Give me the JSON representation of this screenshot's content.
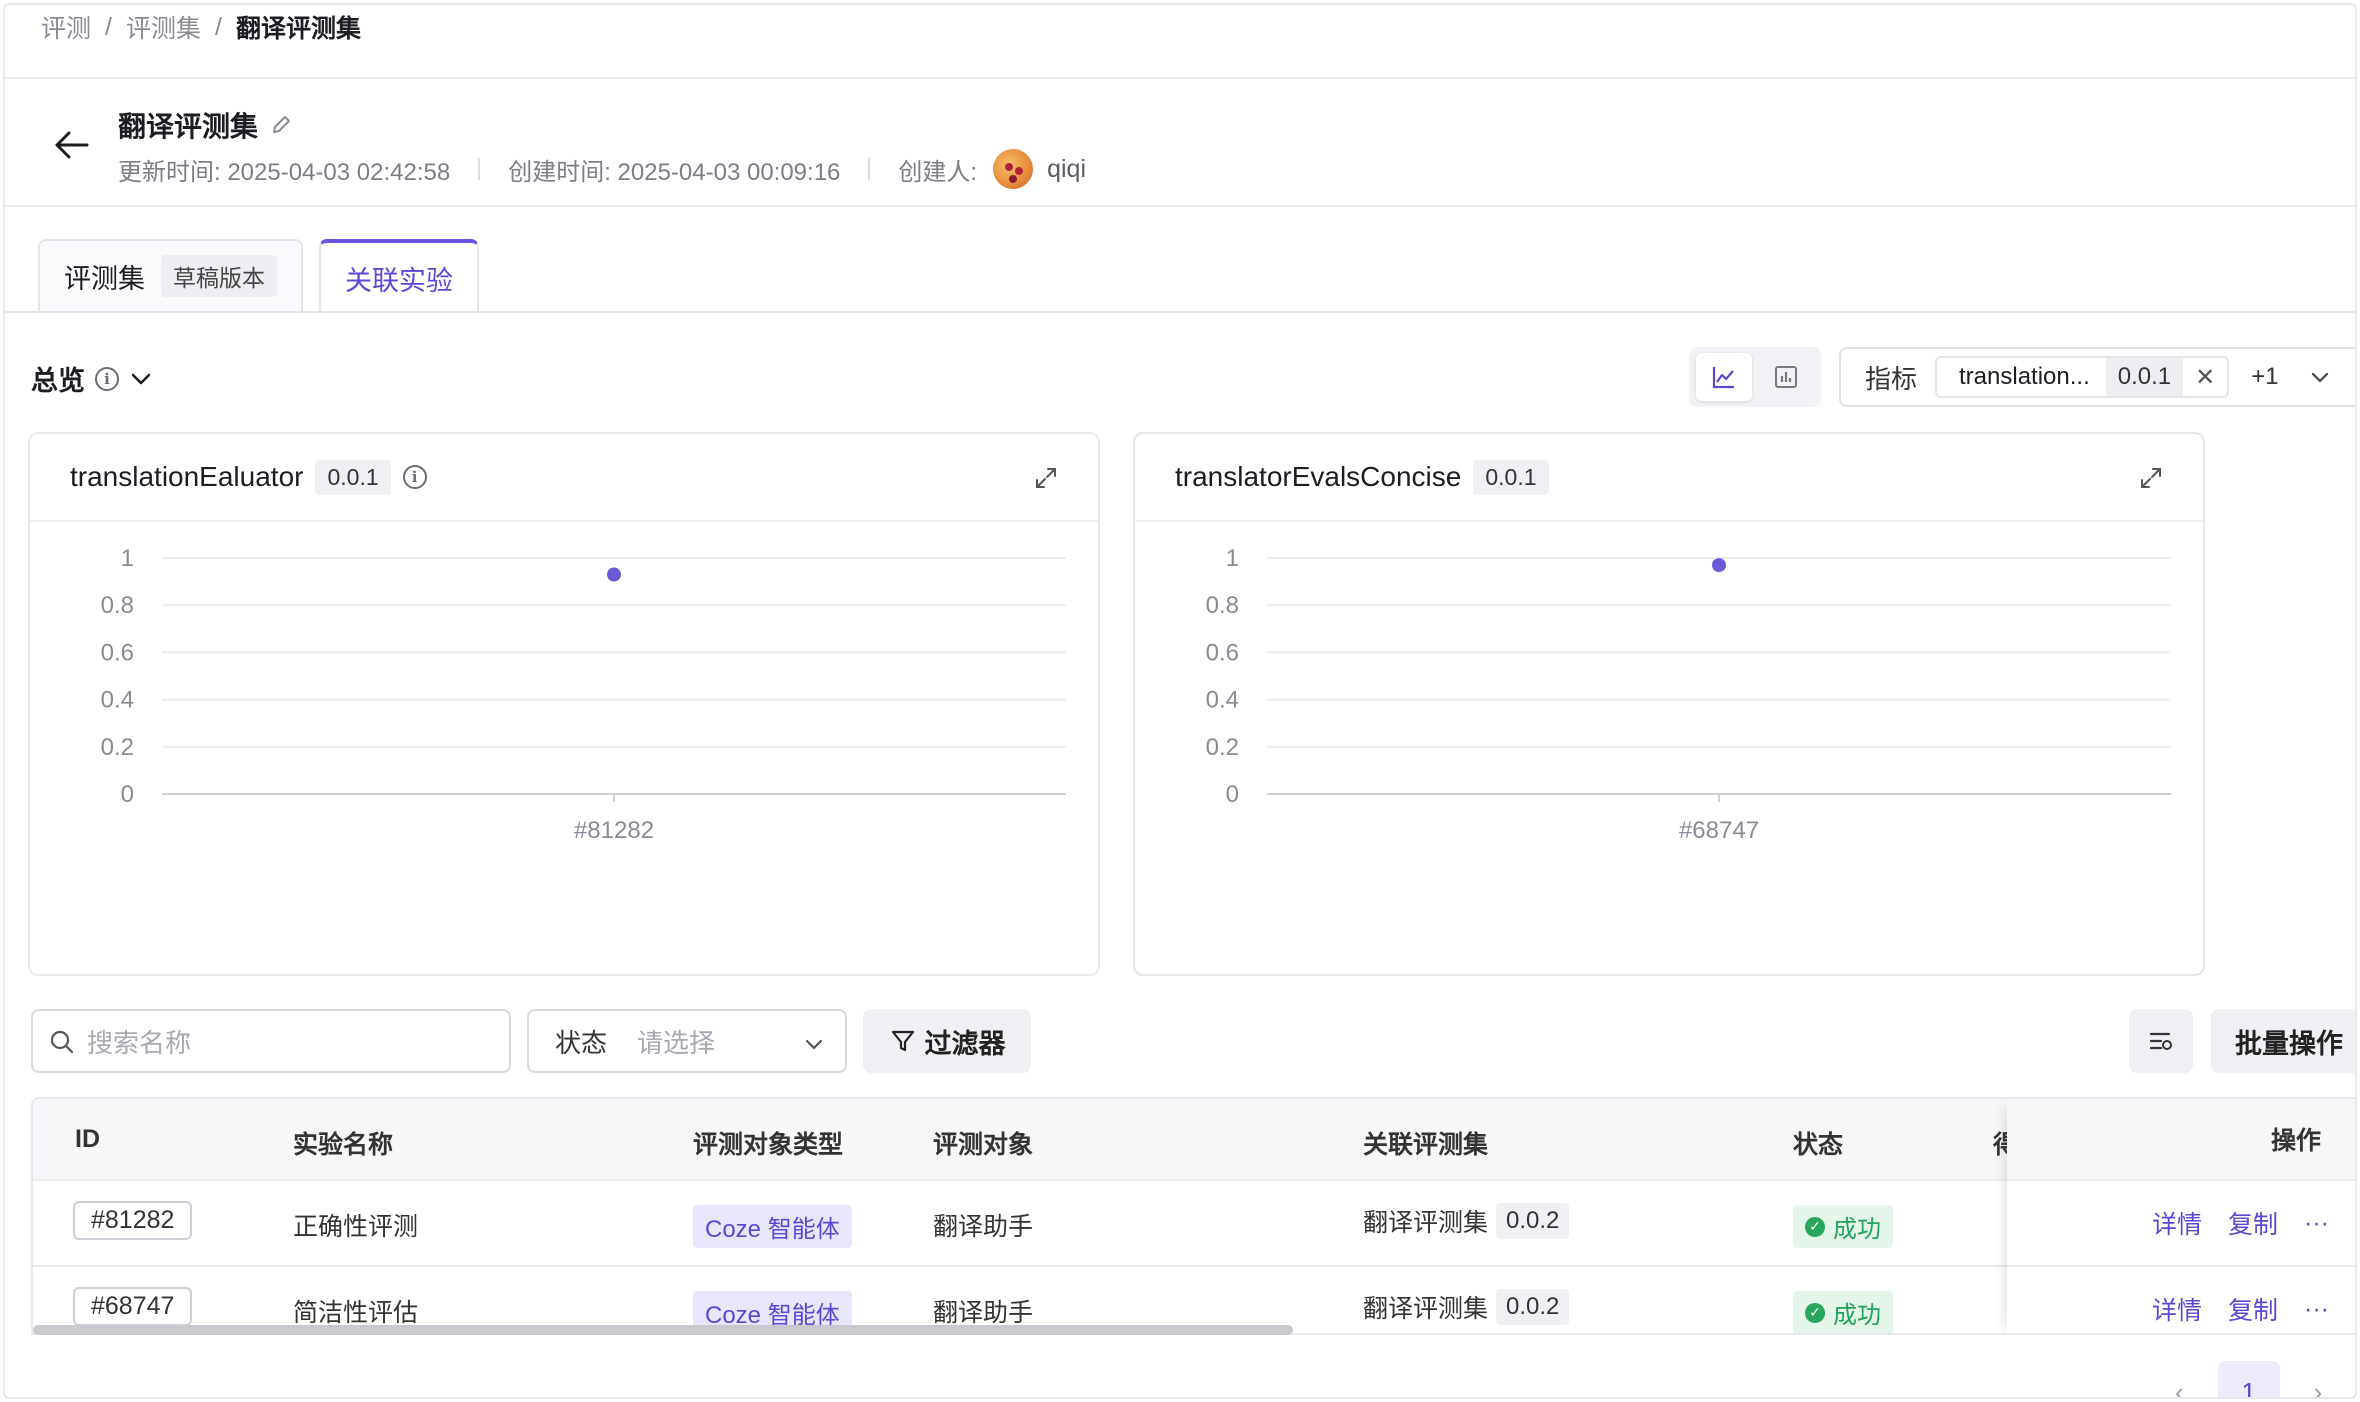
{
  "breadcrumb": [
    "评测",
    "评测集",
    "翻译评测集"
  ],
  "header": {
    "title": "翻译评测集",
    "updated": "更新时间: 2025-04-03 02:42:58",
    "created": "创建时间: 2025-04-03 00:09:16",
    "creator_label": "创建人:",
    "creator": "qiqi"
  },
  "tabs": [
    {
      "label": "评测集",
      "badge": "草稿版本"
    },
    {
      "label": "关联实验"
    }
  ],
  "overview": {
    "label": "总览"
  },
  "metric_filter": {
    "label": "指标",
    "tag": "translation...",
    "tag_version": "0.0.1",
    "more": "+1"
  },
  "charts_meta": [
    {
      "title": "translationEaluator",
      "version": "0.0.1"
    },
    {
      "title": "translatorEvalsConcise",
      "version": "0.0.1"
    }
  ],
  "chart_data": [
    {
      "type": "scatter",
      "title": "translationEaluator",
      "categories": [
        "#81282"
      ],
      "values": [
        0.93
      ],
      "ylim": [
        0,
        1
      ],
      "yticks": [
        "0",
        "0.2",
        "0.4",
        "0.6",
        "0.8",
        "1"
      ],
      "grid": true,
      "color": "#6a5ad6"
    },
    {
      "type": "scatter",
      "title": "translatorEvalsConcise",
      "categories": [
        "#68747"
      ],
      "values": [
        0.97
      ],
      "ylim": [
        0,
        1
      ],
      "yticks": [
        "0",
        "0.2",
        "0.4",
        "0.6",
        "0.8",
        "1"
      ],
      "grid": true,
      "color": "#6a5ad6"
    }
  ],
  "toolbar": {
    "search_placeholder": "搜索名称",
    "status_label": "状态",
    "status_placeholder": "请选择",
    "filter_label": "过滤器",
    "batch_label": "批量操作"
  },
  "table": {
    "headers": {
      "id": "ID",
      "name": "实验名称",
      "type": "评测对象类型",
      "target": "评测对象",
      "dataset": "关联评测集",
      "status": "状态",
      "partial": "得",
      "actions": "操作"
    },
    "rows": [
      {
        "id": "#81282",
        "name": "正确性评测",
        "type": "Coze 智能体",
        "target": "翻译助手",
        "dataset": "翻译评测集",
        "dataset_version": "0.0.2",
        "status": "成功",
        "detail": "详情",
        "copy": "复制",
        "more": "···"
      },
      {
        "id": "#68747",
        "name": "简洁性评估",
        "type": "Coze 智能体",
        "target": "翻译助手",
        "dataset": "翻译评测集",
        "dataset_version": "0.0.2",
        "status": "成功",
        "detail": "详情",
        "copy": "复制",
        "more": "···"
      }
    ]
  },
  "pagination": {
    "current": "1"
  }
}
